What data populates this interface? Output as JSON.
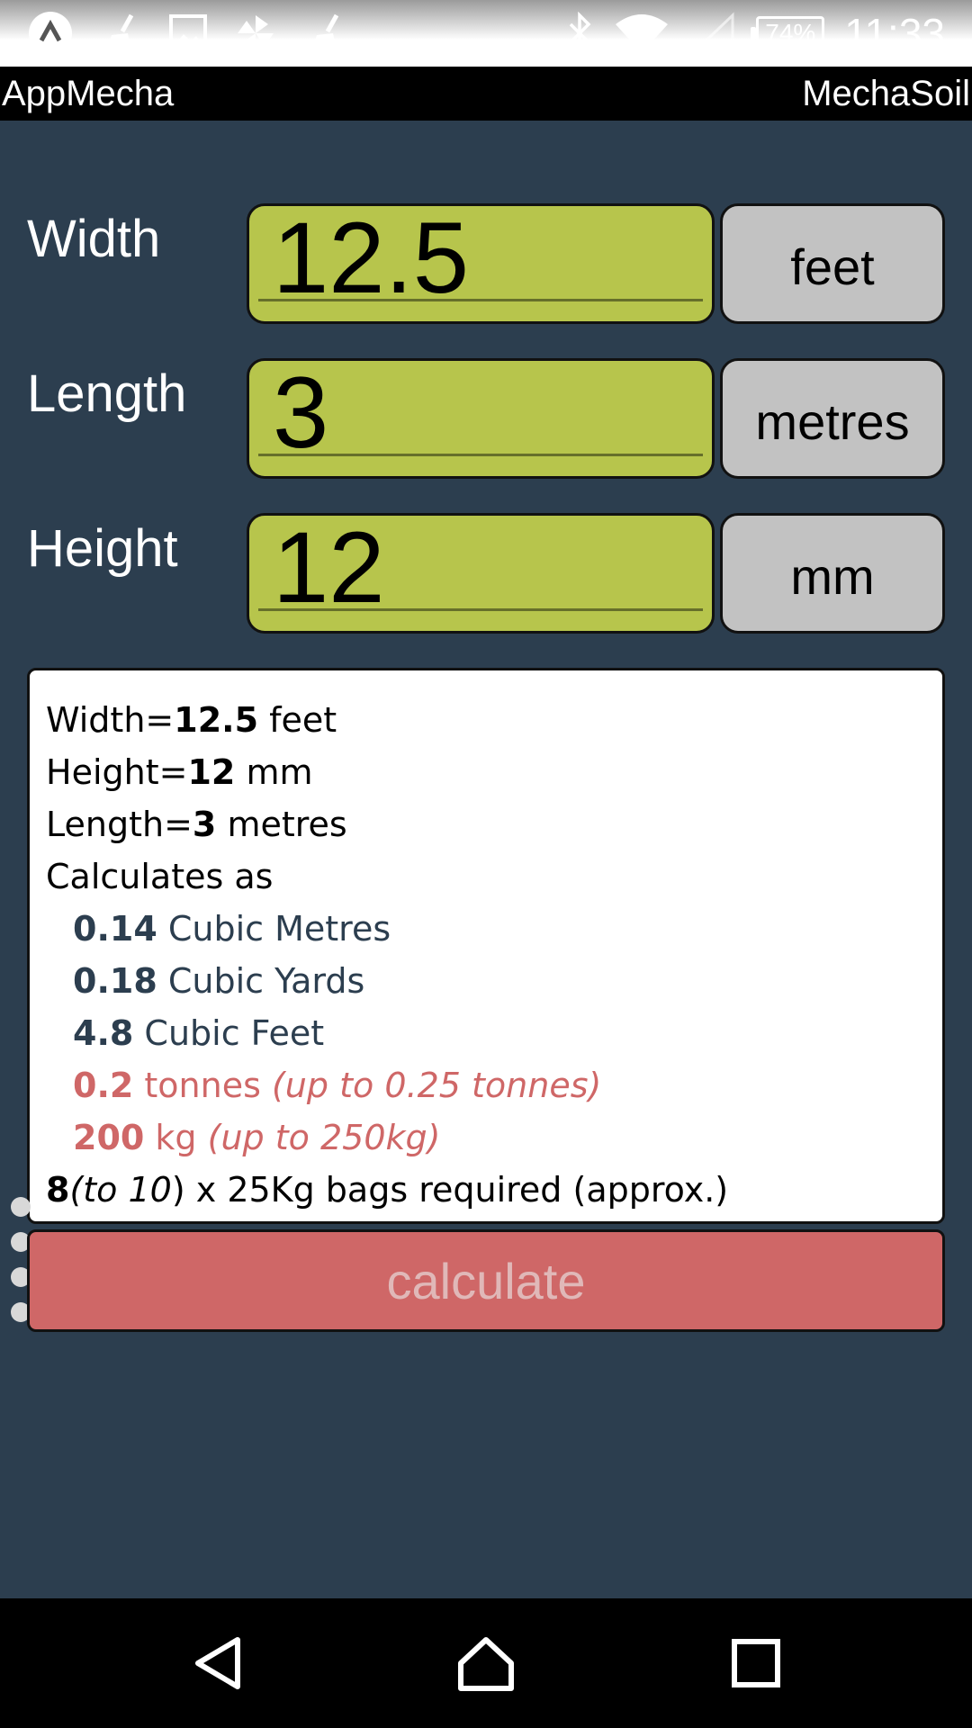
{
  "status_bar": {
    "battery": "74%",
    "time": "11:33",
    "icons": [
      "app-logo-icon",
      "broom-icon",
      "image-icon",
      "pinwheel-icon",
      "broom-icon",
      "bluetooth-icon",
      "wifi-icon",
      "signal-icon",
      "battery-icon"
    ]
  },
  "app_bar": {
    "left_title": "AppMecha",
    "right_title": "MechaSoil"
  },
  "inputs": [
    {
      "label": "Width",
      "value": "12.5",
      "unit": "feet"
    },
    {
      "label": "Length",
      "value": "3",
      "unit": "metres"
    },
    {
      "label": "Height",
      "value": "12",
      "unit": "mm"
    }
  ],
  "results": {
    "width_label": "Width=",
    "width_value": "12.5",
    "width_unit": " feet",
    "height_label": "Height=",
    "height_value": "12",
    "height_unit": " mm",
    "length_label": "Length=",
    "length_value": "3",
    "length_unit": " metres",
    "calc_heading": "Calculates as",
    "cubic_metres_value": "0.14",
    "cubic_metres_label": " Cubic Metres",
    "cubic_yards_value": "0.18",
    "cubic_yards_label": " Cubic Yards",
    "cubic_feet_value": "4.8",
    "cubic_feet_label": " Cubic Feet",
    "tonnes_value": "0.2",
    "tonnes_label": " tonnes ",
    "tonnes_range": "(up to 0.25 tonnes)",
    "kg_value": "200",
    "kg_label": " kg ",
    "kg_range": "(up to 250kg)",
    "bags_value": "8",
    "bags_range": "(to 10",
    "bags_text": ") x 25Kg bags required (approx.)"
  },
  "calculate_button": {
    "label": "calculate"
  },
  "colors": {
    "background": "#2c3e4f",
    "input_fill": "#b7c54c",
    "unit_fill": "#c2c2c2",
    "accent_red": "#cf6767"
  }
}
